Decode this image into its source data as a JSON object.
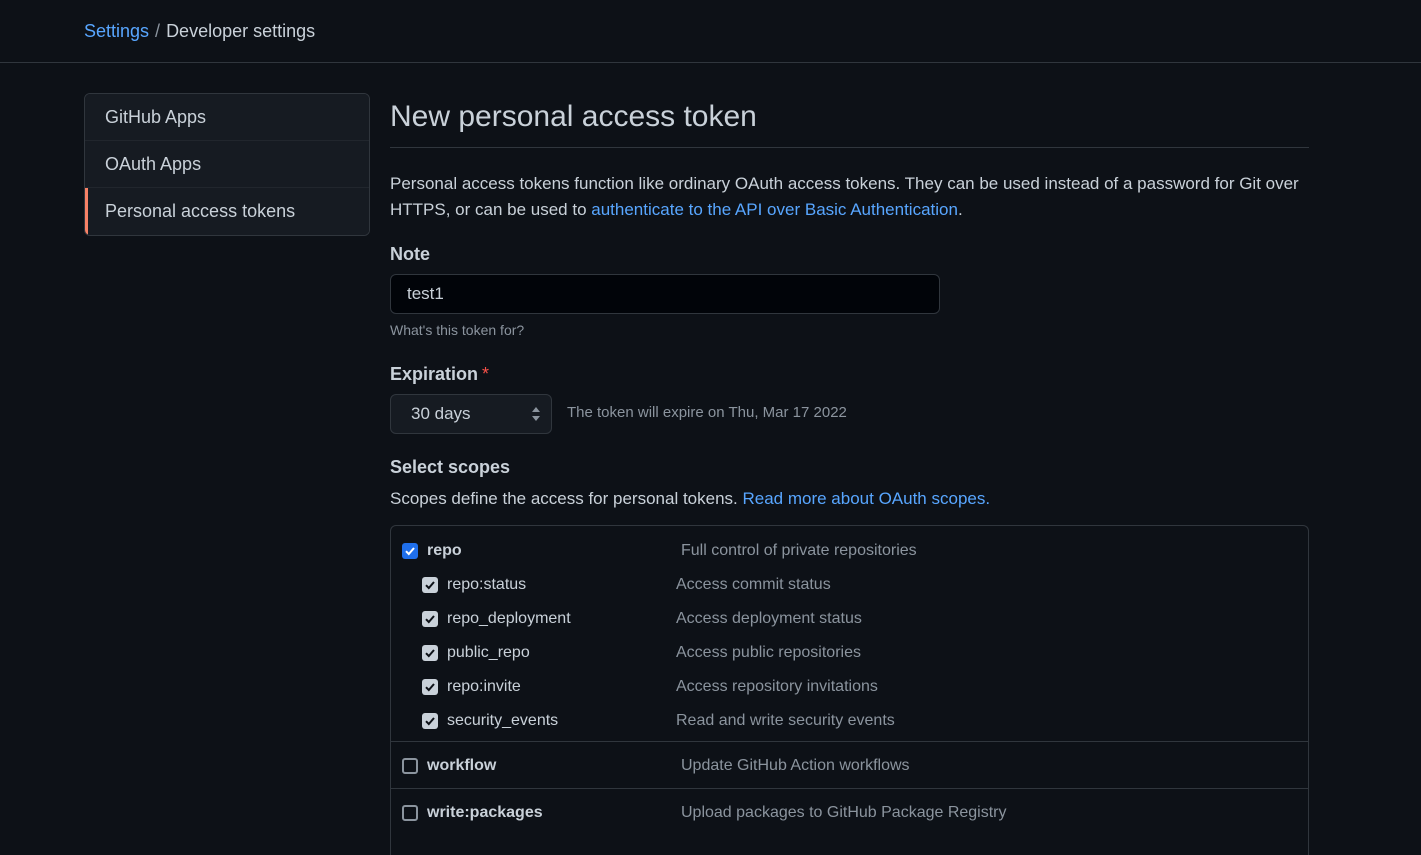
{
  "breadcrumb": {
    "parent": "Settings",
    "separator": "/",
    "current": "Developer settings"
  },
  "sidebar": {
    "items": [
      {
        "label": "GitHub Apps",
        "selected": false
      },
      {
        "label": "OAuth Apps",
        "selected": false
      },
      {
        "label": "Personal access tokens",
        "selected": true
      }
    ]
  },
  "main": {
    "title": "New personal access token",
    "intro_text": "Personal access tokens function like ordinary OAuth access tokens. They can be used instead of a password for Git over HTTPS, or can be used to ",
    "intro_link": "authenticate to the API over Basic Authentication",
    "intro_end": ".",
    "note": {
      "label": "Note",
      "value": "test1",
      "help": "What's this token for?"
    },
    "expiration": {
      "label": "Expiration",
      "required_mark": "*",
      "selected": "30 days",
      "help": "The token will expire on Thu, Mar 17 2022"
    },
    "scopes": {
      "label": "Select scopes",
      "desc": "Scopes define the access for personal tokens. ",
      "link": "Read more about OAuth scopes.",
      "repo": {
        "name": "repo",
        "desc": "Full control of private repositories",
        "checked": true,
        "children": [
          {
            "name": "repo:status",
            "desc": "Access commit status",
            "checked": true
          },
          {
            "name": "repo_deployment",
            "desc": "Access deployment status",
            "checked": true
          },
          {
            "name": "public_repo",
            "desc": "Access public repositories",
            "checked": true
          },
          {
            "name": "repo:invite",
            "desc": "Access repository invitations",
            "checked": true
          },
          {
            "name": "security_events",
            "desc": "Read and write security events",
            "checked": true
          }
        ]
      },
      "workflow": {
        "name": "workflow",
        "desc": "Update GitHub Action workflows",
        "checked": false
      },
      "write_packages": {
        "name": "write:packages",
        "desc": "Upload packages to GitHub Package Registry",
        "checked": false
      }
    }
  },
  "colors": {
    "background": "#0d1117",
    "link": "#58a6ff",
    "selected_accent": "#f78166",
    "checkbox_blue": "#1f6feb",
    "required": "#f85149"
  }
}
